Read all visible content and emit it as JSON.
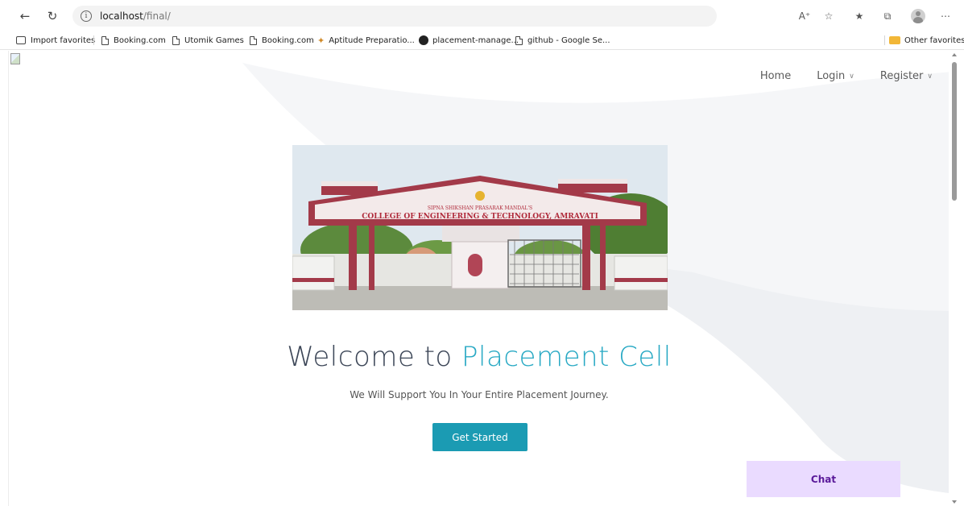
{
  "browser": {
    "url_host": "localhost",
    "url_path": "/final/",
    "bookmarks": [
      "Import favorites",
      "Booking.com",
      "Utomik Games",
      "Booking.com",
      "Aptitude Preparatio...",
      "placement-manage...",
      "github - Google Se..."
    ],
    "other_favorites": "Other favorites"
  },
  "page": {
    "nav": {
      "home": "Home",
      "login": "Login",
      "register": "Register"
    },
    "hero": {
      "gate_line1": "SIPNA SHIKSHAN PRASARAK MANDAL'S",
      "gate_line2": "COLLEGE OF ENGINEERING & TECHNOLOGY, AMRAVATI",
      "title_main": "Welcome to ",
      "title_accent": "Placement Cell",
      "subtitle": "We Will Support You In Your Entire Placement Journey.",
      "cta_label": "Get Started"
    },
    "chat_label": "Chat"
  },
  "colors": {
    "accent": "#28a9c4",
    "button": "#1b9bb3",
    "chat_bg": "#eadbff",
    "chat_text": "#5a1a9a"
  }
}
